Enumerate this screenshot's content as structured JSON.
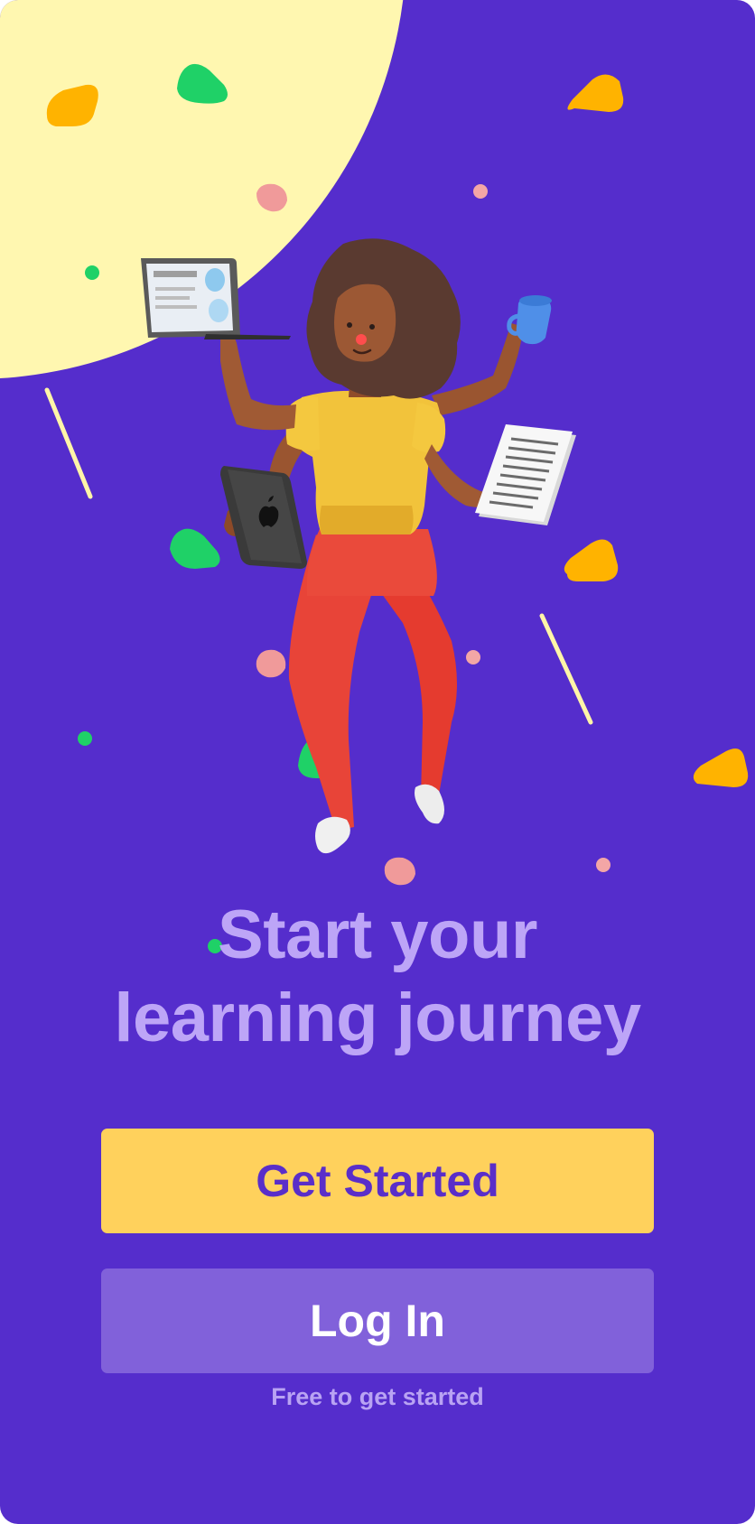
{
  "onboarding": {
    "headline_line1": "Start your",
    "headline_line2": "learning journey",
    "primary_button_label": "Get Started",
    "secondary_button_label": "Log In",
    "footnote": "Free to get started"
  },
  "illustration": {
    "subject": "woman-multitasking-with-laptop-tablet-mug-and-papers",
    "icons": [
      "laptop-icon",
      "tablet-icon",
      "coffee-mug-icon",
      "document-papers-icon"
    ]
  },
  "colors": {
    "background": "#552dcc",
    "sun": "#fff7b0",
    "headline": "#bda5f7",
    "primary_button": "#ffd15c",
    "primary_button_text": "#5a2ec9",
    "secondary_button": "#8161da",
    "secondary_button_text": "#ffffff",
    "footnote": "#b9a3f3",
    "accent_yellow": "#ffb300",
    "accent_green": "#1fd167",
    "accent_pink": "#f09a9a"
  }
}
